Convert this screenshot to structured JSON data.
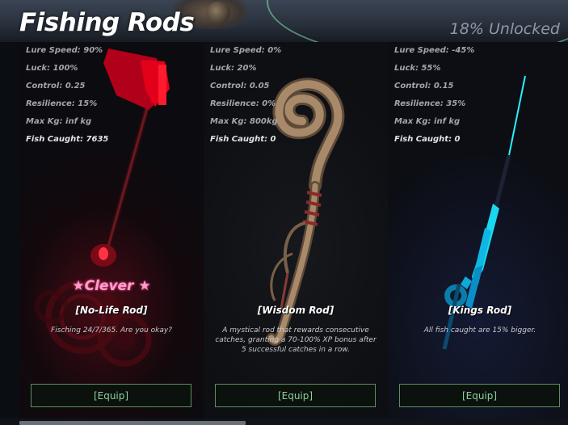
{
  "header": {
    "title": "Fishing Rods",
    "unlocked": "18% Unlocked"
  },
  "labels": {
    "lure_speed": "Lure Speed",
    "luck": "Luck",
    "control": "Control",
    "resilience": "Resilience",
    "max_kg": "Max Kg",
    "fish_caught": "Fish Caught"
  },
  "rods": [
    {
      "name": "[No-Life Rod]",
      "mutation": "★Clever ★",
      "lure_speed": "Lure Speed: 90%",
      "luck": "Luck: 100%",
      "control": "Control: 0.25",
      "resilience": "Resilience: 15%",
      "max_kg": "Max Kg: inf kg",
      "fish_caught": "Fish Caught: 7635",
      "description": "Fisching 24/7/365. Are you okay?",
      "equip_label": "[Equip]",
      "accent": "#e3001b"
    },
    {
      "name": "[Wisdom Rod]",
      "mutation": "",
      "lure_speed": "Lure Speed: 0%",
      "luck": "Luck: 20%",
      "control": "Control: 0.05",
      "resilience": "Resilience: 0%",
      "max_kg": "Max Kg: 800kg",
      "fish_caught": "Fish Caught: 0",
      "description": "A mystical rod that rewards consecutive catches, granting a 70-100% XP bonus after 5 successful catches in a row.",
      "equip_label": "[Equip]",
      "accent": "#a88a6a"
    },
    {
      "name": "[Kings Rod]",
      "mutation": "",
      "lure_speed": "Lure Speed: -45%",
      "luck": "Luck: 55%",
      "control": "Control: 0.15",
      "resilience": "Resilience: 35%",
      "max_kg": "Max Kg: inf kg",
      "fish_caught": "Fish Caught: 0",
      "description": "All fish caught are 15% bigger.",
      "equip_label": "[Equip]",
      "accent": "#1ad8f0"
    }
  ]
}
